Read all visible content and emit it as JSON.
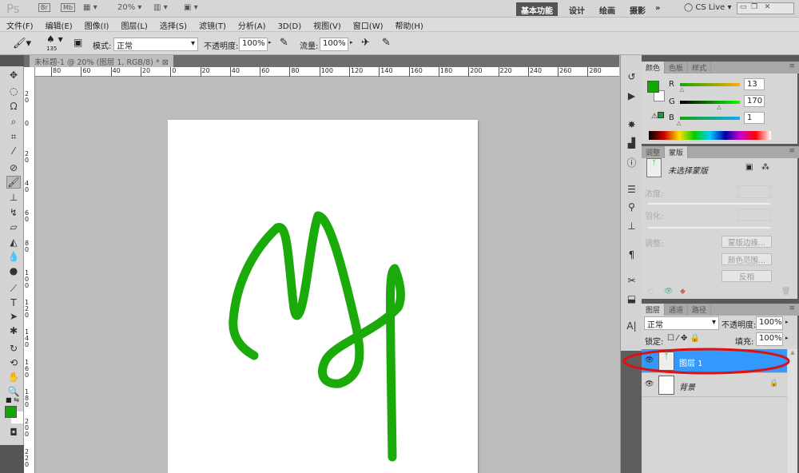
{
  "appbar": {
    "logo": "Ps",
    "br": "Br",
    "mb": "Mb",
    "zoom": "20%",
    "workspaces": [
      "基本功能",
      "设计",
      "绘画",
      "摄影"
    ],
    "more": "»",
    "cslive": "CS Live"
  },
  "menu": [
    "文件(F)",
    "编辑(E)",
    "图像(I)",
    "图层(L)",
    "选择(S)",
    "滤镜(T)",
    "分析(A)",
    "3D(D)",
    "视图(V)",
    "窗口(W)",
    "帮助(H)"
  ],
  "options": {
    "brush_size": "135",
    "mode_label": "模式:",
    "mode_value": "正常",
    "opacity_label": "不透明度:",
    "opacity_value": "100%",
    "flow_label": "流量:",
    "flow_value": "100%"
  },
  "document": {
    "tab_title": "未标题-1 @ 20% (图层 1, RGB/8) *"
  },
  "rulers": {
    "h": [
      "80",
      "60",
      "40",
      "20",
      "0",
      "20",
      "40",
      "60",
      "80",
      "100",
      "120",
      "140",
      "160",
      "180",
      "200",
      "220",
      "240",
      "260",
      "280"
    ],
    "v": [
      "2 0",
      "0",
      "2 0",
      "4 0",
      "6 0",
      "8 0",
      "1 0 0",
      "1 2 0",
      "1 4 0",
      "1 6 0",
      "1 8 0",
      "2 0 0",
      "2 2 0"
    ]
  },
  "colors": {
    "foreground": "#0daa01",
    "stroke": "#1aaa0a",
    "selection": "#3399ff"
  },
  "color_panel": {
    "tabs": [
      "颜色",
      "色板",
      "样式"
    ],
    "r_label": "R",
    "g_label": "G",
    "b_label": "B",
    "r": "13",
    "g": "170",
    "b": "1",
    "r_frac": 0.05,
    "g_frac": 0.67,
    "b_frac": 0.0
  },
  "masks_panel": {
    "tabs": [
      "调整",
      "蒙版"
    ],
    "title": "未选择蒙版",
    "density": "浓度:",
    "feather": "羽化:",
    "refine": "调整:",
    "btn_edge": "蒙版边缘...",
    "btn_range": "颜色范围...",
    "btn_invert": "反相"
  },
  "layers_panel": {
    "tabs": [
      "图层",
      "通道",
      "路径"
    ],
    "blend": "正常",
    "opacity_label": "不透明度:",
    "opacity": "100%",
    "lock_label": "锁定:",
    "fill_label": "填充:",
    "fill": "100%",
    "layers": [
      {
        "name": "图层 1",
        "selected": true
      },
      {
        "name": "背景",
        "selected": false
      }
    ]
  }
}
